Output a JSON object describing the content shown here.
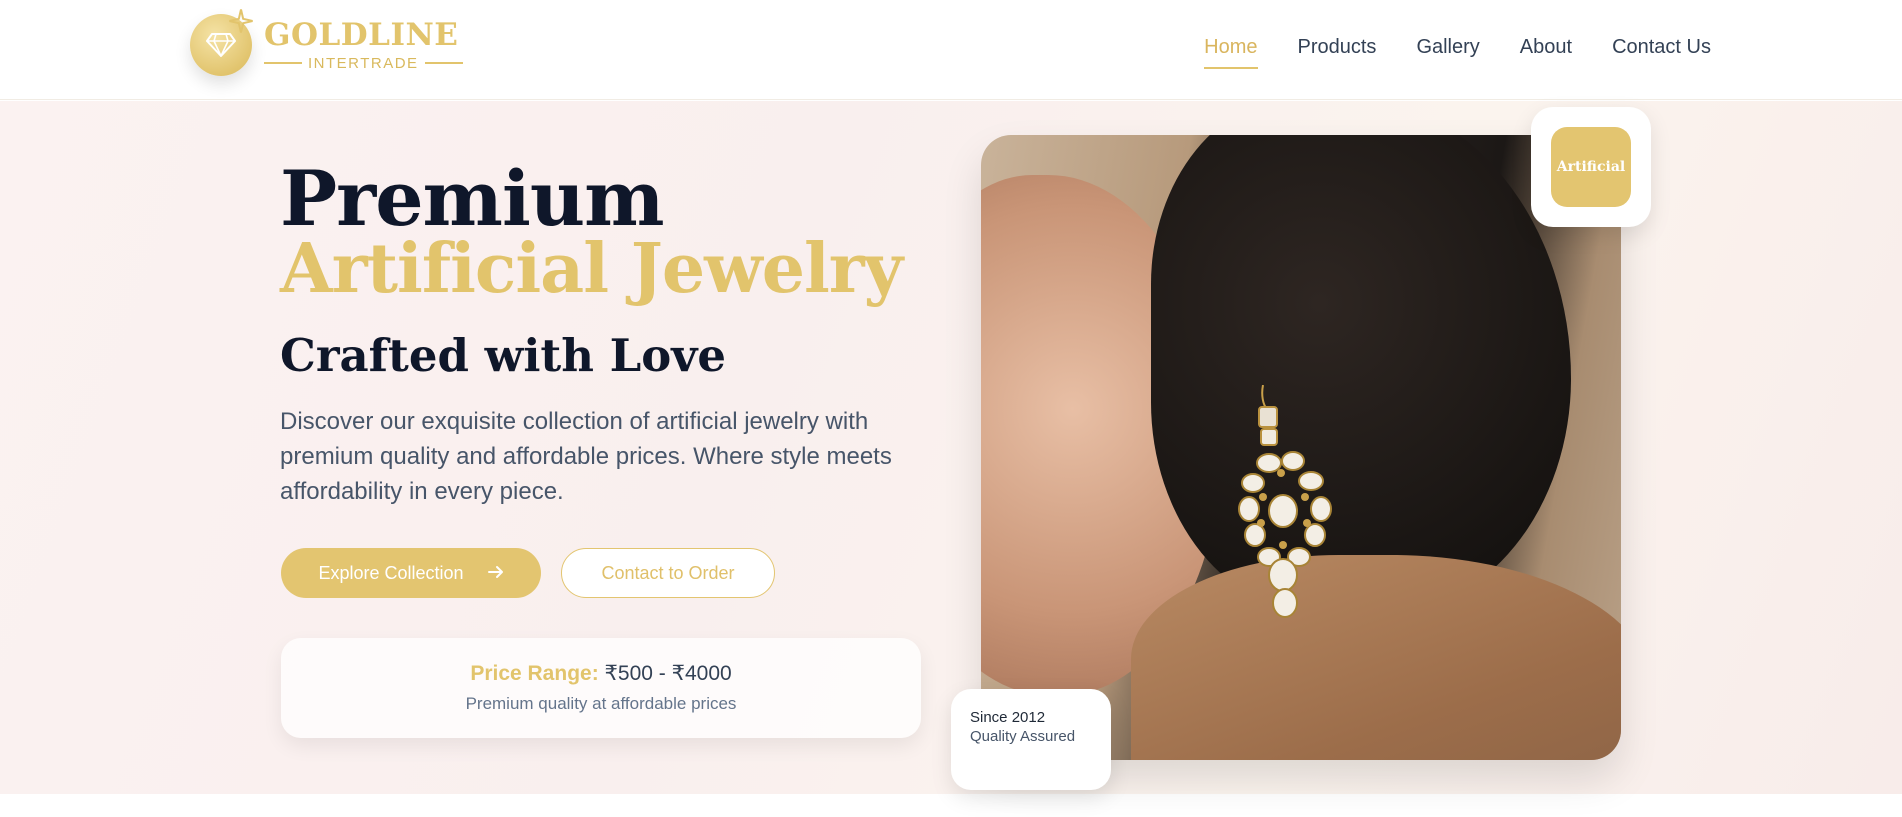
{
  "brand": {
    "name": "GOLDLINE",
    "tagline": "INTERTRADE"
  },
  "nav": {
    "items": [
      {
        "label": "Home",
        "active": true
      },
      {
        "label": "Products",
        "active": false
      },
      {
        "label": "Gallery",
        "active": false
      },
      {
        "label": "About",
        "active": false
      },
      {
        "label": "Contact Us",
        "active": false
      }
    ]
  },
  "hero": {
    "title_line1": "Premium",
    "title_line2": "Artificial Jewelry",
    "subtitle": "Crafted with Love",
    "description": "Discover our exquisite collection of artificial jewelry with premium quality and affordable prices. Where style meets affordability in every piece.",
    "primary_button": "Explore Collection",
    "primary_button_icon": "arrow-right-icon",
    "secondary_button": "Contact to Order",
    "price_label": "Price Range:",
    "price_value": "₹500 - ₹4000",
    "price_note": "Premium quality at affordable prices",
    "tag_label": "Artificial",
    "since_year": "Since 2012",
    "since_note": "Quality Assured"
  },
  "colors": {
    "accent": "#e3c570",
    "text_dark": "#0f172a",
    "text_muted": "#475569"
  }
}
